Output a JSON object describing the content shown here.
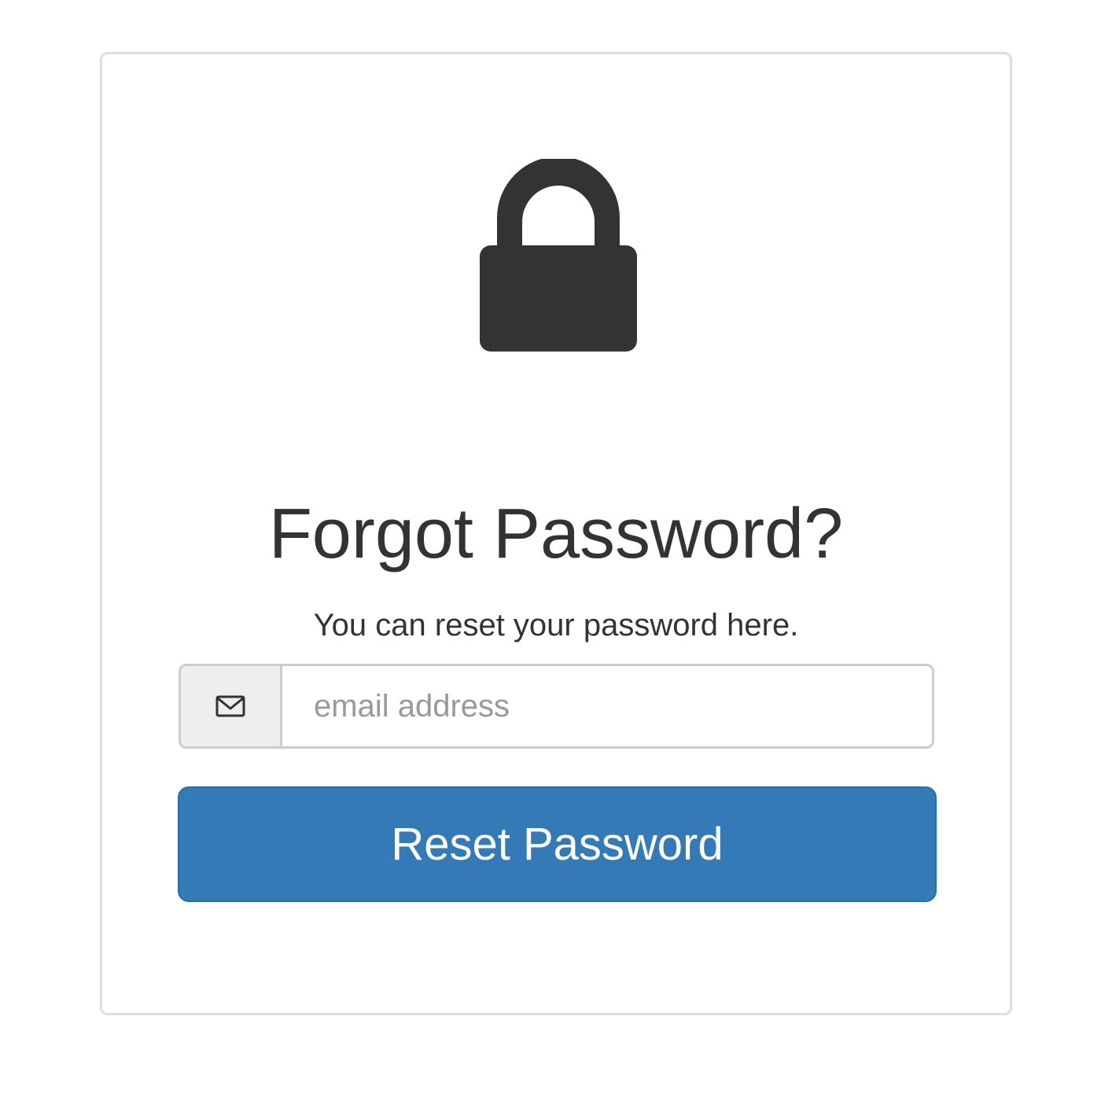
{
  "panel": {
    "lock_icon": "lock-icon",
    "title": "Forgot Password?",
    "subtitle": "You can reset your password here.",
    "email_field": {
      "icon": "envelope-icon",
      "placeholder": "email address",
      "value": ""
    },
    "reset_button_label": "Reset Password"
  },
  "colors": {
    "icon": "#333333",
    "button_bg": "#337ab7",
    "button_text": "#ffffff",
    "addon_bg": "#eeeeee",
    "border": "#cccccc"
  }
}
